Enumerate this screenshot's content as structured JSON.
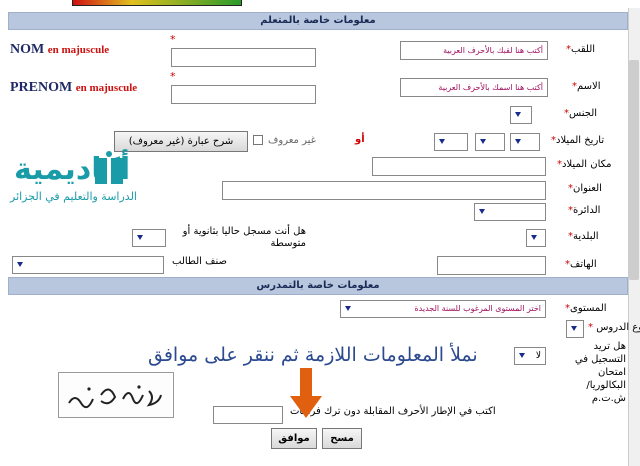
{
  "section_student": {
    "title": "معلومات خاصة بالمتعلم"
  },
  "section_study": {
    "title": "معلومات خاصة بالتمدرس"
  },
  "star": "*",
  "nom": {
    "label_fr": "NOM",
    "sub_fr": "en majuscule",
    "label_ar": "اللقب",
    "hint": "أكتب هنا لقبك بالأحرف العربية"
  },
  "prenom": {
    "label_fr": "PRENOM",
    "sub_fr": "en majuscule",
    "label_ar": "الاسم",
    "hint": "أكتب هنا اسمك بالأحرف العربية"
  },
  "gender": {
    "label": "الجنس"
  },
  "birthdate": {
    "label": "تاريخ الميلاد",
    "or_text": "أو",
    "unknown_text": "غير معروف",
    "explain_button": "شرح عبارة (غير معروف)"
  },
  "birthplace": {
    "label": "مكان الميلاد"
  },
  "address": {
    "label": "العنوان"
  },
  "daira": {
    "label": "الدائرة"
  },
  "commune": {
    "label": "البلدية"
  },
  "enrolled_question": "هل أنت مسجل حاليا بثانوية أو متوسطة",
  "phone": {
    "label": "الهاتف"
  },
  "student_class": {
    "label": "صنف الطالب"
  },
  "level": {
    "label": "المستوى",
    "placeholder": "اختر المستوى المرغوب للسنة الجديدة"
  },
  "study_type": {
    "label": "نوع الدروس:"
  },
  "bac_question": "هل تريد التسجيل في امتحان البكالوريا/ ش.ت.م",
  "bac_value": "لا",
  "captcha": {
    "text": "ع ن 4 ه 2",
    "prompt": "اكتب في الإطار الأحرف المقابلة دون ترك فراغات"
  },
  "buttons": {
    "submit": "موافق",
    "clear": "مسح"
  },
  "logo": {
    "title": "أكاديمية",
    "subtitle": "الدراسة والتعليم في الجزائر"
  },
  "instruction": "نملأ المعلومات اللازمة ثم ننقر على موافق",
  "colors": {
    "section_bar": "#b8c7de",
    "required_star": "#d00000",
    "hint_text": "#a01060",
    "logo": "#1a9ca8",
    "instruction": "#2b4a8f",
    "arrow": "#e06010"
  }
}
